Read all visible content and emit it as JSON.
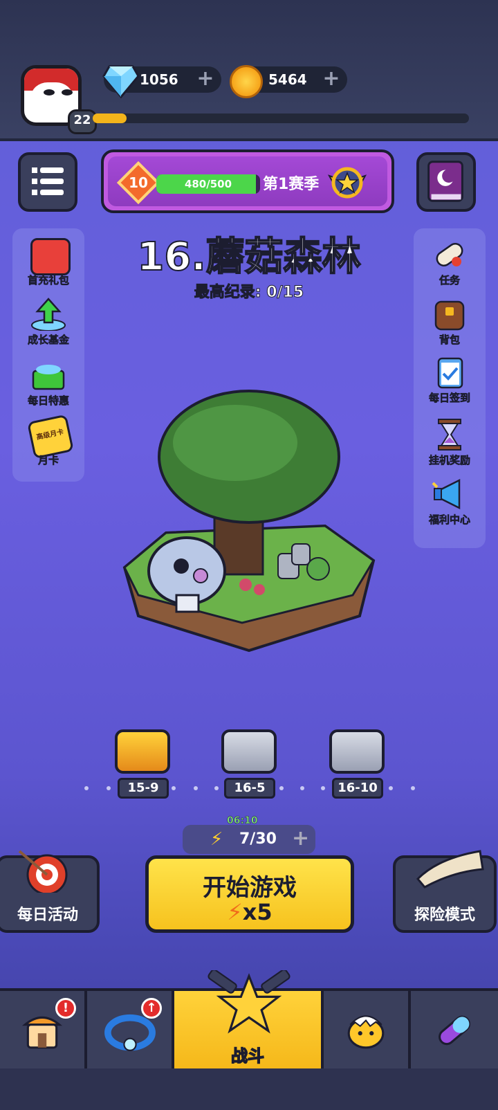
{
  "player": {
    "level": "22",
    "xp_fraction": 0.09
  },
  "currency": {
    "gems": "1056",
    "coins": "5464"
  },
  "season": {
    "level": "10",
    "progress_text": "480/500",
    "progress_fraction": 0.96,
    "label": "第1赛季"
  },
  "stage": {
    "title": "16.蘑菇森林",
    "best_record": "最高纪录: 0/15"
  },
  "left_menu": [
    {
      "label": "首充礼包",
      "icon": "gift-box-icon"
    },
    {
      "label": "成长基金",
      "icon": "growth-fund-icon"
    },
    {
      "label": "每日特惠",
      "icon": "basket-icon"
    },
    {
      "label": "月卡",
      "icon": "monthly-card-icon",
      "card_text": "高级月卡"
    }
  ],
  "right_menu": [
    {
      "label": "任务",
      "icon": "scroll-icon"
    },
    {
      "label": "背包",
      "icon": "backpack-icon"
    },
    {
      "label": "每日签到",
      "icon": "clipboard-check-icon"
    },
    {
      "label": "挂机奖励",
      "icon": "hourglass-icon"
    },
    {
      "label": "福利中心",
      "icon": "megaphone-icon"
    }
  ],
  "chests": [
    {
      "label": "15-9",
      "type": "gold-open"
    },
    {
      "label": "16-5",
      "type": "silver"
    },
    {
      "label": "16-10",
      "type": "silver"
    }
  ],
  "energy": {
    "timer": "06:10",
    "value": "7/30"
  },
  "start_button": {
    "label": "开始游戏",
    "cost": "x5"
  },
  "daily_activity": {
    "label": "每日活动"
  },
  "adventure_mode": {
    "label": "探险模式"
  },
  "bottom_nav": [
    {
      "icon": "shop-house-icon",
      "badge": "!"
    },
    {
      "icon": "ring-icon",
      "badge": "↑"
    },
    {
      "label": "战斗",
      "icon": "battle-star-icon",
      "active": true
    },
    {
      "icon": "chick-egg-icon"
    },
    {
      "icon": "capsule-icon"
    }
  ]
}
